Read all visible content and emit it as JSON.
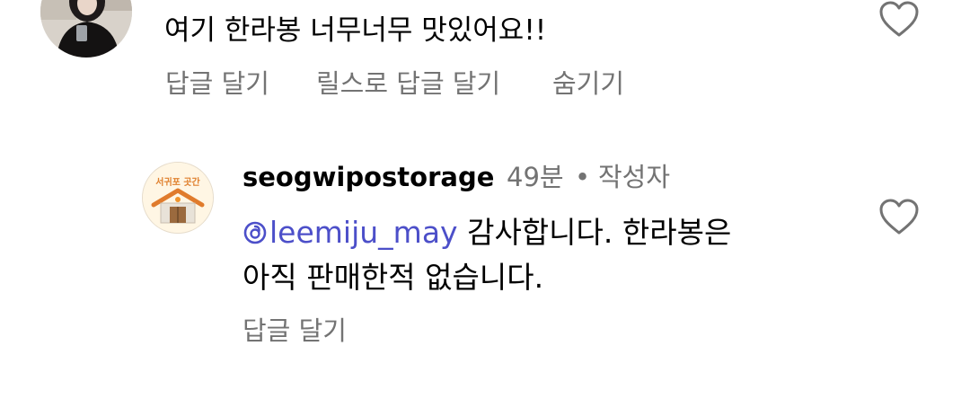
{
  "comment": {
    "text": "여기 한라봉 너무너무 맛있어요!!",
    "actions": {
      "reply": "답글 달기",
      "reply_with_reels": "릴스로 답글 달기",
      "hide": "숨기기"
    }
  },
  "reply": {
    "username": "seogwipostorage",
    "time": "49분",
    "separator": "•",
    "author_badge": "작성자",
    "mention": "leemiju_may",
    "text_line1": "감사합니다. 한라봉은",
    "text_line2": "아직 판매한적 없습니다.",
    "avatar_logo_text": "서귀포 곳간",
    "actions": {
      "reply": "답글 달기"
    }
  },
  "colors": {
    "secondary_text": "#737373",
    "mention": "#4c4fc9",
    "avatar_house_roof": "#e07b2c"
  },
  "icons": {
    "like": "heart-outline-icon",
    "mention": "threads-icon"
  }
}
